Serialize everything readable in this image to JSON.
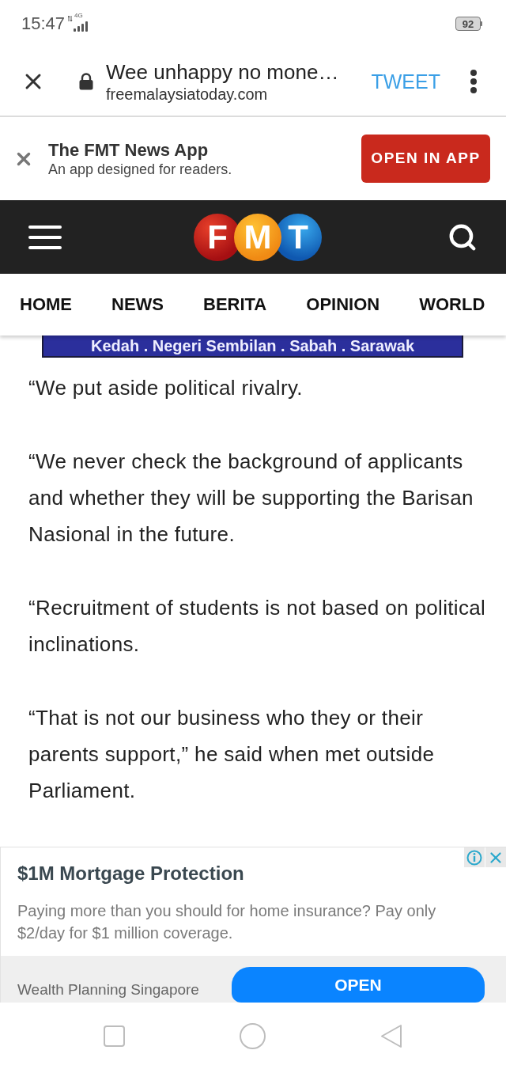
{
  "status_bar": {
    "time": "15:47",
    "network": "4G",
    "battery": "92"
  },
  "browser_bar": {
    "title": "Wee unhappy no mone…",
    "domain": "freemalaysiatoday.com",
    "action": "TWEET"
  },
  "app_banner": {
    "title": "The FMT News App",
    "subtitle": "An app designed for readers.",
    "button": "OPEN IN APP"
  },
  "site_header": {
    "logo": [
      "F",
      "M",
      "T"
    ]
  },
  "nav_tabs": [
    "HOME",
    "NEWS",
    "BERITA",
    "OPINION",
    "WORLD"
  ],
  "region_banner": "Kedah . Negeri Sembilan . Sabah . Sarawak",
  "article": {
    "paragraphs": [
      "“We put aside political rivalry.",
      "“We never check the background of applicants and whether they will be supporting the Barisan Nasional in the future.",
      "“Recruitment of students is not based on political inclinations.",
      "“That is not our business who they or their parents support,” he said when met outside Parliament."
    ]
  },
  "ad": {
    "title": "$1M Mortgage Protection",
    "body": "Paying more than you should for home insurance? Pay only $2/day for $1 million coverage.",
    "advertiser": "Wealth Planning Singapore",
    "button": "OPEN"
  }
}
